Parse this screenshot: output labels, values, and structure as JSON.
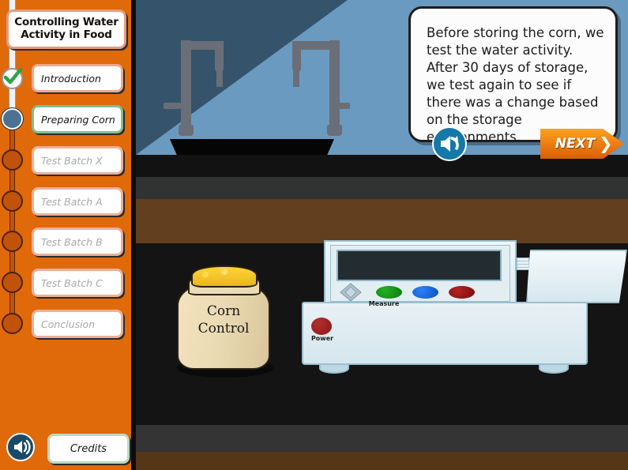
{
  "app": {
    "title": "Controlling Water Activity in Food"
  },
  "sidebar": {
    "items": [
      {
        "label": "Introduction",
        "state": "done"
      },
      {
        "label": "Preparing Corn",
        "state": "active"
      },
      {
        "label": "Test Batch X",
        "state": "todo"
      },
      {
        "label": "Test Batch A",
        "state": "todo"
      },
      {
        "label": "Test Batch B",
        "state": "todo"
      },
      {
        "label": "Test Batch C",
        "state": "todo"
      },
      {
        "label": "Conclusion",
        "state": "todo"
      }
    ],
    "credits_label": "Credits",
    "mute_icon": "speaker-icon"
  },
  "bubble": {
    "text": "Before storing the corn, we test the water activity. After 30 days of storage, we test again to see if there was a change based on the storage environments.",
    "replay_icon": "speaker-replay-icon",
    "next_label": "NEXT",
    "next_chevron": "❯"
  },
  "scene": {
    "sack_line1": "Corn",
    "sack_line2": "Control",
    "instrument": {
      "measure_label": "Measure",
      "power_label": "Power",
      "buttons": [
        {
          "name": "dpad",
          "color": "#A8BCC6"
        },
        {
          "name": "green",
          "color": "#119211"
        },
        {
          "name": "blue",
          "color": "#0B63E5"
        },
        {
          "name": "red",
          "color": "#9A1212"
        }
      ],
      "screen_value": ""
    }
  },
  "colors": {
    "sidebar_orange": "#E0690A",
    "track_incomplete": "#C0520A",
    "wall_light": "#6A9AC0",
    "wall_shadow": "#35546B",
    "counter_brown": "#613F1F",
    "band_gray": "#313333",
    "floor_dark": "#141414",
    "accent_next": "#EE7F12",
    "active_border": "#7FBF8F",
    "todo_border": "#EBAF99",
    "current_node": "#4C7193"
  }
}
